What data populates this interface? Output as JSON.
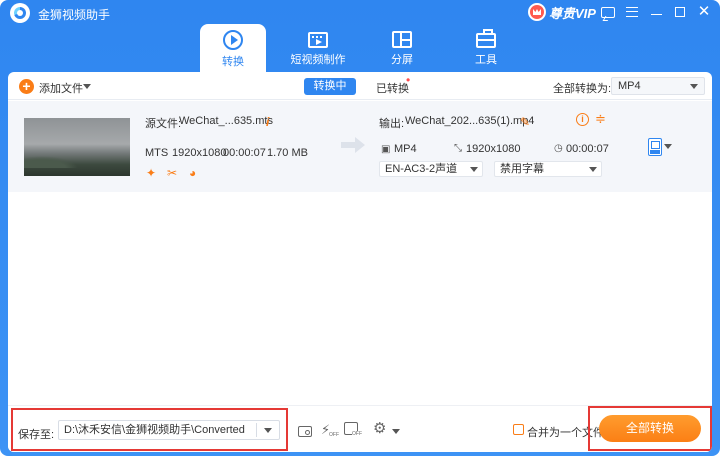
{
  "app": {
    "title": "金狮视频助手",
    "vip_label": "尊贵VIP"
  },
  "nav": {
    "tabs": [
      {
        "label": "转换",
        "icon": "convert-icon",
        "active": true
      },
      {
        "label": "短视频制作",
        "icon": "video-clap-icon",
        "active": false
      },
      {
        "label": "分屏",
        "icon": "split-screen-icon",
        "active": false
      },
      {
        "label": "工具",
        "icon": "toolbox-icon",
        "active": false
      }
    ]
  },
  "toolbar": {
    "add_file": "添加文件",
    "seg_converting": "转换中",
    "seg_converted": "已转换",
    "convert_all_to_label": "全部转换为:",
    "convert_all_format": "MP4"
  },
  "file": {
    "source_label": "源文件:",
    "source_name": "WeChat_...635.mts",
    "src_format": "MTS",
    "src_resolution": "1920x1080",
    "src_duration": "00:00:07",
    "src_size": "1.70 MB",
    "output_label": "输出:",
    "output_name": "WeChat_202...635(1).mp4",
    "out_format": "MP4",
    "out_resolution": "1920x1080",
    "out_duration": "00:00:07",
    "audio_track": "EN-AC3-2声道",
    "subtitle": "禁用字幕"
  },
  "bottom": {
    "save_to_label": "保存至:",
    "save_path": "D:\\沐禾安信\\金狮视频助手\\Converted",
    "merge_label": "合并为一个文件",
    "convert_all_button": "全部转换",
    "off_label": "OFF"
  },
  "colors": {
    "brand_blue": "#2f86f0",
    "accent_orange": "#fa7d17",
    "highlight_red": "#e53935"
  }
}
